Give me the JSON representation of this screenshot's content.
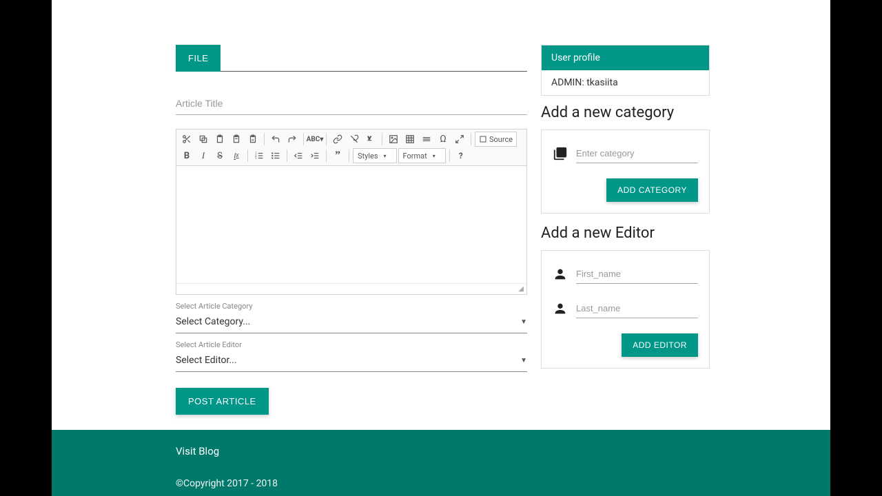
{
  "tabs": {
    "file": "FILE"
  },
  "article": {
    "title_placeholder": "Article Title",
    "category_label": "Select Article Category",
    "category_value": "Select Category...",
    "editor_label": "Select Article Editor",
    "editor_value": "Select Editor...",
    "post_button": "POST ARTICLE"
  },
  "toolbar": {
    "styles": "Styles",
    "format": "Format",
    "source": "Source"
  },
  "profile": {
    "header": "User profile",
    "value": "ADMIN: tkasiita"
  },
  "category_form": {
    "title": "Add a new category",
    "placeholder": "Enter category",
    "button": "ADD CATEGORY"
  },
  "editor_form": {
    "title": "Add a new Editor",
    "first_placeholder": "First_name",
    "last_placeholder": "Last_name",
    "button": "ADD EDITOR"
  },
  "footer": {
    "link": "Visit Blog",
    "copyright": "©Copyright 2017 - 2018"
  }
}
